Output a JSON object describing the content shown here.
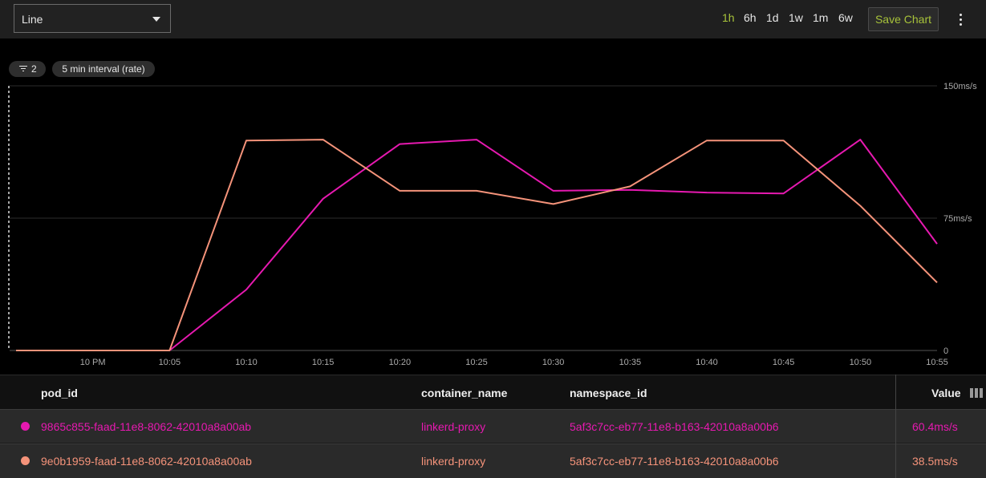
{
  "toolbar": {
    "chart_type": "Line",
    "ranges": [
      "1h",
      "6h",
      "1d",
      "1w",
      "1m",
      "6w"
    ],
    "active_range": "1h",
    "save_label": "Save Chart"
  },
  "chips": {
    "filter_count": "2",
    "interval": "5 min interval (rate)"
  },
  "colors": {
    "series_1": "#e619b0",
    "series_2": "#f5937a",
    "accent": "#a7c23a"
  },
  "chart_data": {
    "type": "line",
    "x": [
      "21:55",
      "22:00",
      "22:05",
      "22:10",
      "22:15",
      "22:20",
      "22:25",
      "22:30",
      "22:35",
      "22:40",
      "22:45",
      "22:50",
      "22:55"
    ],
    "x_tick_labels": [
      "10 PM",
      "10:05",
      "10:10",
      "10:15",
      "10:20",
      "10:25",
      "10:30",
      "10:35",
      "10:40",
      "10:45",
      "10:50",
      "10:55"
    ],
    "y_tick_labels": [
      "150ms/s",
      "75ms/s",
      "0"
    ],
    "ylim": [
      0,
      150
    ],
    "grid": true,
    "series": [
      {
        "name": "9865c855-faad-11e8-8062-42010a8a00ab",
        "color": "#e619b0",
        "values": [
          0,
          0,
          0,
          34.5,
          86,
          117,
          119.5,
          90.5,
          91,
          89.5,
          89,
          119.5,
          60.4
        ]
      },
      {
        "name": "9e0b1959-faad-11e8-8062-42010a8a00ab",
        "color": "#f5937a",
        "values": [
          0,
          0,
          0,
          119,
          119.5,
          90.5,
          90.5,
          83,
          93,
          119,
          119,
          82,
          38.5
        ]
      }
    ]
  },
  "table": {
    "headers": {
      "pod_id": "pod_id",
      "container_name": "container_name",
      "namespace_id": "namespace_id",
      "value": "Value"
    },
    "rows": [
      {
        "pod_id": "9865c855-faad-11e8-8062-42010a8a00ab",
        "container_name": "linkerd-proxy",
        "namespace_id": "5af3c7cc-eb77-11e8-b163-42010a8a00b6",
        "value": "60.4ms/s",
        "color": "#e619b0"
      },
      {
        "pod_id": "9e0b1959-faad-11e8-8062-42010a8a00ab",
        "container_name": "linkerd-proxy",
        "namespace_id": "5af3c7cc-eb77-11e8-b163-42010a8a00b6",
        "value": "38.5ms/s",
        "color": "#f5937a"
      }
    ]
  }
}
